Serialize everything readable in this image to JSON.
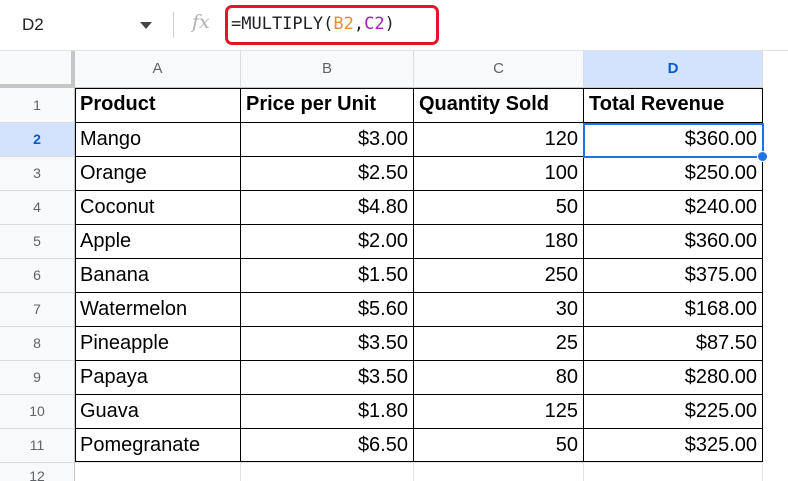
{
  "formula_bar": {
    "name_box": "D2",
    "fx_symbol": "fx",
    "formula_prefix": "=MULTIPLY(",
    "formula_ref1": "B2",
    "formula_sep": ",",
    "formula_ref2": "C2",
    "formula_suffix": ")"
  },
  "columns": [
    "A",
    "B",
    "C",
    "D"
  ],
  "rows": [
    "1",
    "2",
    "3",
    "4",
    "5",
    "6",
    "7",
    "8",
    "9",
    "10",
    "11",
    "12"
  ],
  "selected_cell": "D2",
  "colors": {
    "selection": "#1a73e8",
    "formula_highlight": "#e5142a",
    "ref_b": "#e69138",
    "ref_c": "#9c27b0"
  },
  "table": {
    "headers": [
      "Product",
      "Price per Unit",
      "Quantity Sold",
      "Total Revenue"
    ],
    "rows": [
      [
        "Mango",
        "$3.00",
        "120",
        "$360.00"
      ],
      [
        "Orange",
        "$2.50",
        "100",
        "$250.00"
      ],
      [
        "Coconut",
        "$4.80",
        "50",
        "$240.00"
      ],
      [
        "Apple",
        "$2.00",
        "180",
        "$360.00"
      ],
      [
        "Banana",
        "$1.50",
        "250",
        "$375.00"
      ],
      [
        "Watermelon",
        "$5.60",
        "30",
        "$168.00"
      ],
      [
        "Pineapple",
        "$3.50",
        "25",
        "$87.50"
      ],
      [
        "Papaya",
        "$3.50",
        "80",
        "$280.00"
      ],
      [
        "Guava",
        "$1.80",
        "125",
        "$225.00"
      ],
      [
        "Pomegranate",
        "$6.50",
        "50",
        "$325.00"
      ]
    ]
  }
}
